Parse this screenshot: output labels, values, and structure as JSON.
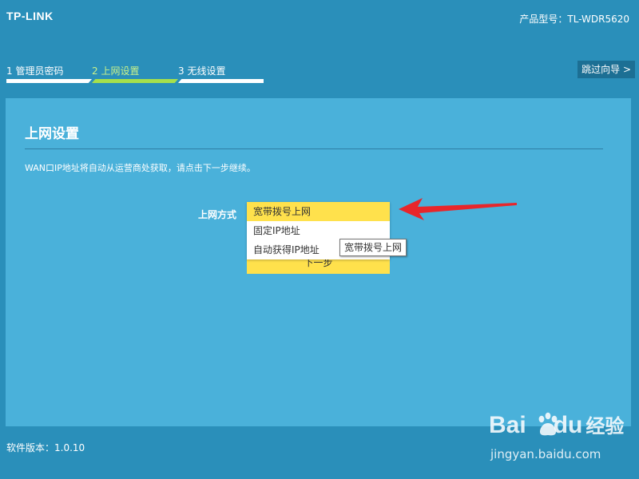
{
  "header": {
    "logo": "TP-LINK",
    "model": "产品型号：TL-WDR5620"
  },
  "steps": [
    {
      "label": "1 管理员密码",
      "active": false
    },
    {
      "label": "2 上网设置",
      "active": true
    },
    {
      "label": "3 无线设置",
      "active": false
    }
  ],
  "skip_button": "跳过向导 >",
  "card": {
    "title": "上网设置",
    "description": "WAN口IP地址将自动从运营商处获取，请点击下一步继续。",
    "field_label": "上网方式",
    "options": [
      {
        "label": "宽带拨号上网",
        "selected": true
      },
      {
        "label": "固定IP地址",
        "selected": false
      },
      {
        "label": "自动获得IP地址",
        "selected": false
      }
    ],
    "tooltip": "宽带拨号上网",
    "next_button": "下一步"
  },
  "footer": {
    "version": "软件版本：1.0.10"
  },
  "watermark": {
    "logo_left": "Bai",
    "logo_right": "du",
    "logo_jingyan": "经验",
    "url": "jingyan.baidu.com"
  },
  "colors": {
    "page_bg": "#2a8fba",
    "card_bg": "#4ab1da",
    "accent_yellow": "#ffe14c",
    "step_active": "#a6e04c",
    "arrow_red": "#e8262b"
  }
}
